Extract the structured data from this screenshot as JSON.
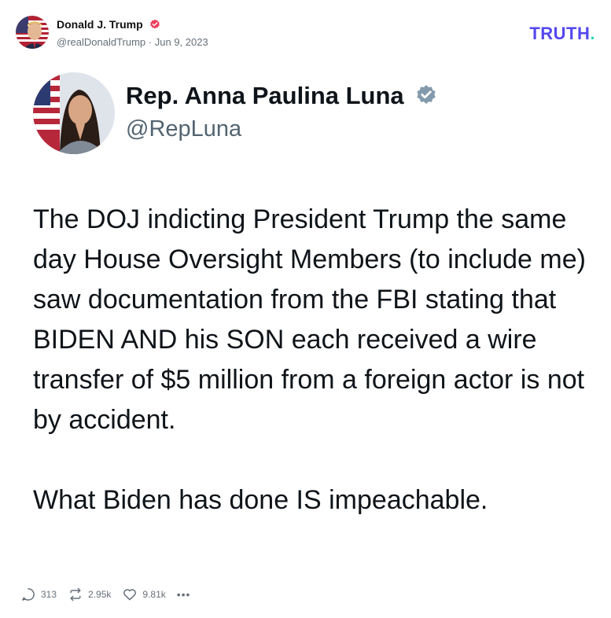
{
  "post": {
    "author_name": "Donald J. Trump",
    "author_handle": "@realDonaldTrump",
    "separator": "·",
    "date": "Jun 9, 2023",
    "brand": {
      "text": "TRUTH",
      "dot": "."
    },
    "colors": {
      "brand": "#5448ee",
      "brand_dot": "#2fd8b5",
      "verified": "#f03e5c",
      "meta": "#67707a"
    }
  },
  "embedded_tweet": {
    "name": "Rep. Anna Paulina Luna",
    "handle": "@RepLuna",
    "paragraph1": "The DOJ indicting President Trump the same day House Oversight Members (to include me) saw documentation from the FBI stating that BIDEN AND his SON each received a wire transfer of $5 million from a foreign actor is not by accident.",
    "paragraph2": "What Biden has done IS impeachable.",
    "colors": {
      "verified": "#829aab",
      "handle": "#536471"
    }
  },
  "actions": {
    "replies": "313",
    "retruths": "2.95k",
    "likes": "9.81k",
    "icons": [
      "reply-icon",
      "retruth-icon",
      "like-icon",
      "more-icon"
    ]
  }
}
